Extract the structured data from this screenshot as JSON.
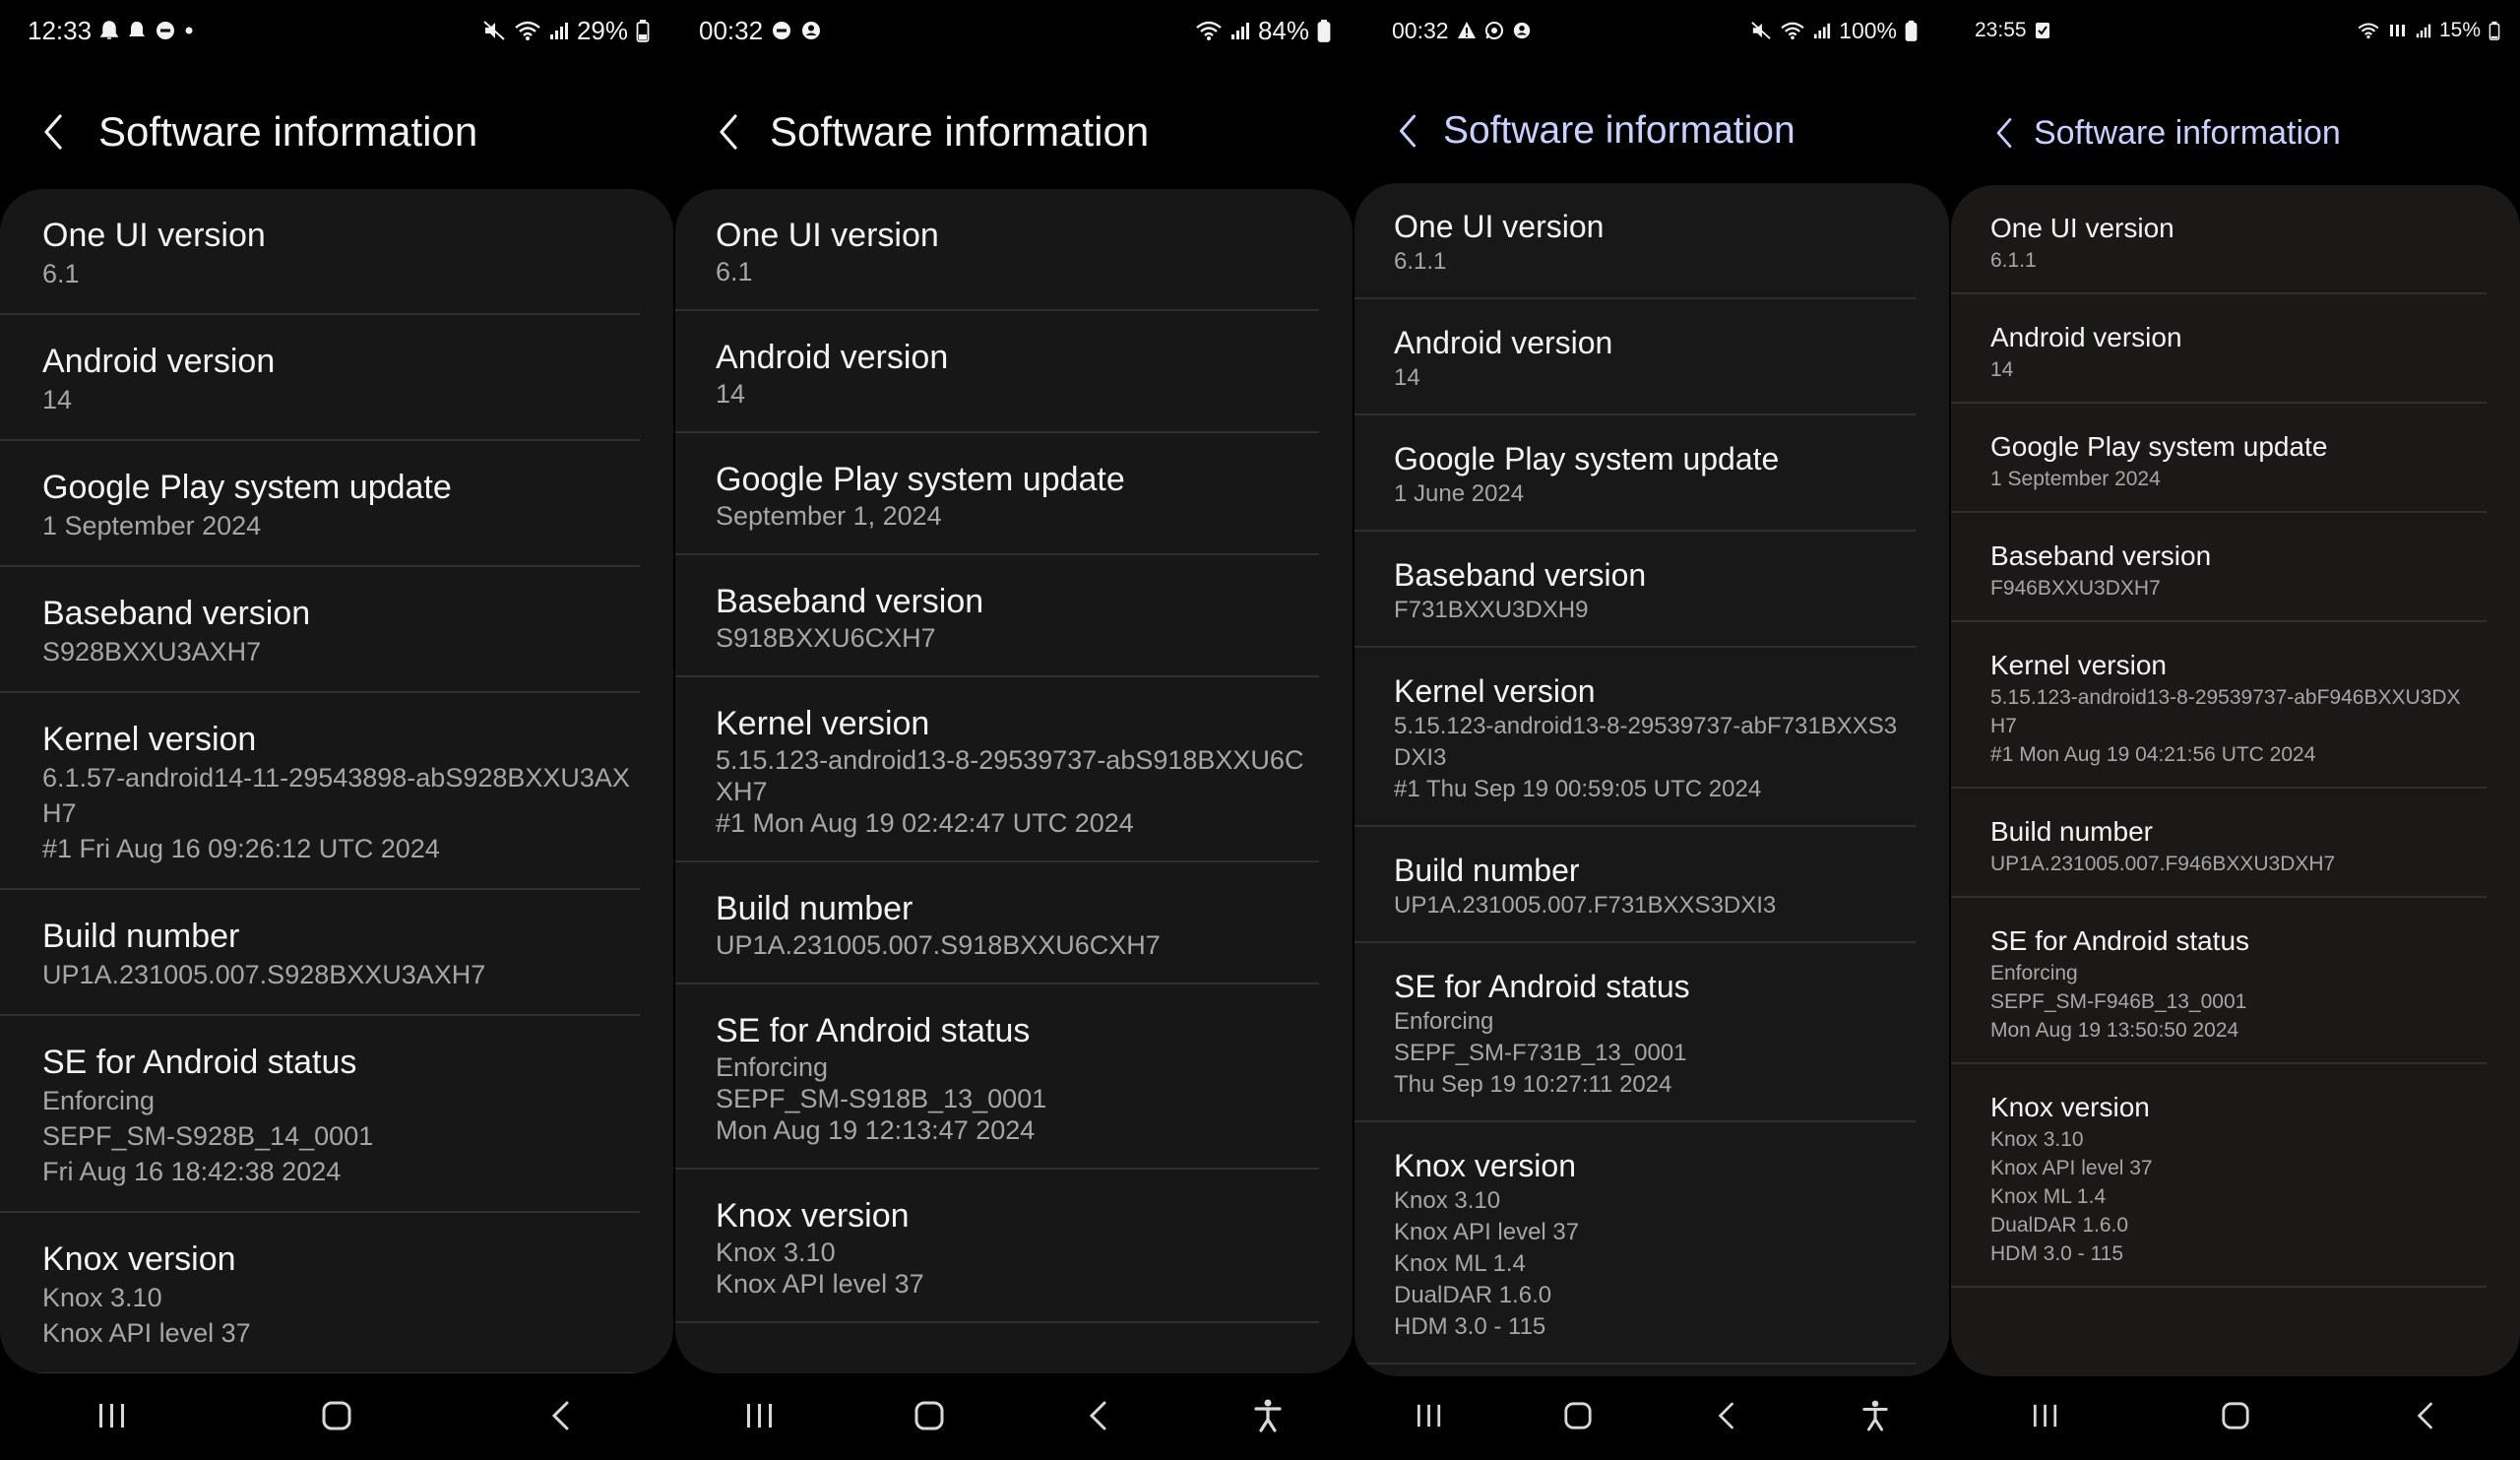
{
  "phones": [
    {
      "status": {
        "time": "12:33",
        "battery": "29%"
      },
      "title": "Software information",
      "items": [
        {
          "title": "One UI version",
          "lines": [
            "6.1"
          ]
        },
        {
          "title": "Android version",
          "lines": [
            "14"
          ]
        },
        {
          "title": "Google Play system update",
          "lines": [
            "1 September 2024"
          ]
        },
        {
          "title": "Baseband version",
          "lines": [
            "S928BXXU3AXH7"
          ]
        },
        {
          "title": "Kernel version",
          "lines": [
            "6.1.57-android14-11-29543898-abS928BXXU3AX",
            "H7",
            "#1 Fri Aug 16 09:26:12 UTC 2024"
          ]
        },
        {
          "title": "Build number",
          "lines": [
            "UP1A.231005.007.S928BXXU3AXH7"
          ]
        },
        {
          "title": "SE for Android status",
          "lines": [
            "Enforcing",
            "SEPF_SM-S928B_14_0001",
            "Fri Aug 16 18:42:38 2024"
          ]
        },
        {
          "title": "Knox version",
          "lines": [
            "Knox 3.10",
            "Knox API level 37"
          ]
        }
      ]
    },
    {
      "status": {
        "time": "00:32",
        "battery": "84%"
      },
      "title": "Software information",
      "items": [
        {
          "title": "One UI version",
          "lines": [
            "6.1"
          ]
        },
        {
          "title": "Android version",
          "lines": [
            "14"
          ]
        },
        {
          "title": "Google Play system update",
          "lines": [
            "September 1, 2024"
          ]
        },
        {
          "title": "Baseband version",
          "lines": [
            "S918BXXU6CXH7"
          ]
        },
        {
          "title": "Kernel version",
          "lines": [
            "5.15.123-android13-8-29539737-abS918BXXU6C",
            "XH7",
            "#1 Mon Aug 19 02:42:47 UTC 2024"
          ]
        },
        {
          "title": "Build number",
          "lines": [
            "UP1A.231005.007.S918BXXU6CXH7"
          ]
        },
        {
          "title": "SE for Android status",
          "lines": [
            "Enforcing",
            "SEPF_SM-S918B_13_0001",
            "Mon Aug 19 12:13:47 2024"
          ]
        },
        {
          "title": "Knox version",
          "lines": [
            "Knox 3.10",
            "Knox API level 37"
          ]
        }
      ]
    },
    {
      "status": {
        "time": "00:32",
        "battery": "100%"
      },
      "title": "Software information",
      "items": [
        {
          "title": "One UI version",
          "lines": [
            "6.1.1"
          ]
        },
        {
          "title": "Android version",
          "lines": [
            "14"
          ]
        },
        {
          "title": "Google Play system update",
          "lines": [
            "1 June 2024"
          ]
        },
        {
          "title": "Baseband version",
          "lines": [
            "F731BXXU3DXH9"
          ]
        },
        {
          "title": "Kernel version",
          "lines": [
            "5.15.123-android13-8-29539737-abF731BXXS3",
            "DXI3",
            "#1 Thu Sep 19 00:59:05 UTC 2024"
          ]
        },
        {
          "title": "Build number",
          "lines": [
            "UP1A.231005.007.F731BXXS3DXI3"
          ]
        },
        {
          "title": "SE for Android status",
          "lines": [
            "Enforcing",
            "SEPF_SM-F731B_13_0001",
            "Thu Sep 19 10:27:11 2024"
          ]
        },
        {
          "title": "Knox version",
          "lines": [
            "Knox 3.10",
            "Knox API level 37",
            "Knox ML 1.4",
            "DualDAR 1.6.0",
            "HDM 3.0 - 115"
          ]
        }
      ]
    },
    {
      "status": {
        "time": "23:55",
        "battery": "15%"
      },
      "title": "Software information",
      "items": [
        {
          "title": "One UI version",
          "lines": [
            "6.1.1"
          ]
        },
        {
          "title": "Android version",
          "lines": [
            "14"
          ]
        },
        {
          "title": "Google Play system update",
          "lines": [
            "1 September 2024"
          ]
        },
        {
          "title": "Baseband version",
          "lines": [
            "F946BXXU3DXH7"
          ]
        },
        {
          "title": "Kernel version",
          "lines": [
            "5.15.123-android13-8-29539737-abF946BXXU3DX",
            "H7",
            "#1 Mon Aug 19 04:21:56 UTC 2024"
          ]
        },
        {
          "title": "Build number",
          "lines": [
            "UP1A.231005.007.F946BXXU3DXH7"
          ]
        },
        {
          "title": "SE for Android status",
          "lines": [
            "Enforcing",
            "SEPF_SM-F946B_13_0001",
            "Mon Aug 19 13:50:50 2024"
          ]
        },
        {
          "title": "Knox version",
          "lines": [
            "Knox 3.10",
            "Knox API level 37",
            "Knox ML 1.4",
            "DualDAR 1.6.0",
            "HDM 3.0 - 115"
          ]
        }
      ]
    }
  ]
}
